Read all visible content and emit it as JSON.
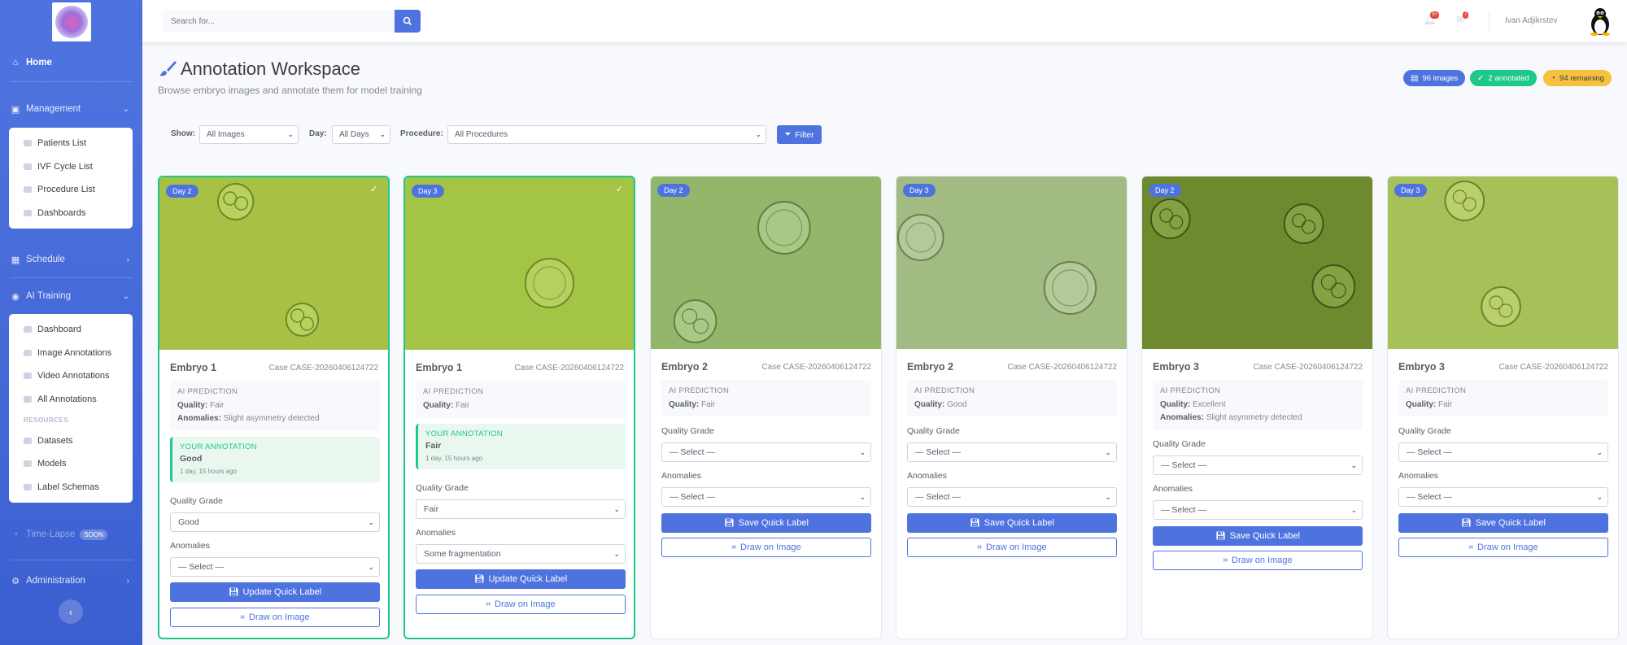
{
  "sidebar": {
    "home": "Home",
    "management": "Management",
    "management_items": [
      "Patients List",
      "IVF Cycle List",
      "Procedure List",
      "Dashboards"
    ],
    "schedule": "Schedule",
    "ai_training": "AI Training",
    "ai_items": [
      "Dashboard",
      "Image Annotations",
      "Video Annotations",
      "All Annotations"
    ],
    "resources_header": "RESOURCES",
    "resource_items": [
      "Datasets",
      "Models",
      "Label Schemas"
    ],
    "timelapse": "Time-Lapse",
    "soon": "SOON",
    "administration": "Administration"
  },
  "topbar": {
    "search_placeholder": "Search for...",
    "alerts_count": "3+",
    "messages_count": "7",
    "username": "Ivan Adjikrstev"
  },
  "header": {
    "title": "Annotation Workspace",
    "subtitle": "Browse embryo images and annotate them for model training",
    "stats": {
      "images": "96 images",
      "annotated": "2 annotated",
      "remaining": "94 remaining"
    }
  },
  "filters": {
    "show_label": "Show:",
    "show_value": "All Images",
    "day_label": "Day:",
    "day_value": "All Days",
    "procedure_label": "Procedure:",
    "procedure_value": "All Procedures",
    "filter_button": "Filter"
  },
  "labels": {
    "ai_prediction": "AI PREDICTION",
    "quality": "Quality:",
    "anomalies": "Anomalies:",
    "your_annotation": "YOUR ANNOTATION",
    "quality_grade": "Quality Grade",
    "anomalies_field": "Anomalies",
    "save": "Save Quick Label",
    "update": "Update Quick Label",
    "draw": "Draw on Image"
  },
  "cards": [
    {
      "day": "Day 2",
      "embryo": "Embryo 1",
      "case": "Case CASE-20260406124722",
      "quality": "Fair",
      "anomalies": "Slight asymmetry detected",
      "your_grade": "Good",
      "your_time": "1 day, 15 hours ago",
      "grade_value": "Good",
      "anomaly_value": "— Select —"
    },
    {
      "day": "Day 3",
      "embryo": "Embryo 1",
      "case": "Case CASE-20260406124722",
      "quality": "Fair",
      "anomalies": "",
      "your_grade": "Fair",
      "your_time": "1 day, 15 hours ago",
      "grade_value": "Fair",
      "anomaly_value": "Some fragmentation"
    },
    {
      "day": "Day 2",
      "embryo": "Embryo 2",
      "case": "Case CASE-20260406124722",
      "quality": "Fair",
      "anomalies": "",
      "grade_value": "— Select —",
      "anomaly_value": "— Select —"
    },
    {
      "day": "Day 3",
      "embryo": "Embryo 2",
      "case": "Case CASE-20260406124722",
      "quality": "Good",
      "anomalies": "",
      "grade_value": "— Select —",
      "anomaly_value": "— Select —"
    },
    {
      "day": "Day 2",
      "embryo": "Embryo 3",
      "case": "Case CASE-20260406124722",
      "quality": "Excellent",
      "anomalies": "Slight asymmetry detected",
      "grade_value": "— Select —",
      "anomaly_value": "— Select —"
    },
    {
      "day": "Day 3",
      "embryo": "Embryo 3",
      "case": "Case CASE-20260406124722",
      "quality": "Fair",
      "anomalies": "",
      "grade_value": "— Select —",
      "anomaly_value": "— Select —"
    }
  ],
  "colors": {
    "primary": "#4e73df",
    "success": "#1cc88a",
    "warning": "#f6c23e"
  }
}
